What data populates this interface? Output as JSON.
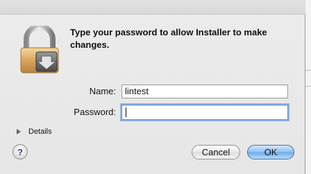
{
  "dialog": {
    "message": "Type your password to allow Installer to make changes.",
    "name_label": "Name:",
    "name_value": "lintest",
    "password_label": "Password:",
    "password_value": "",
    "details_label": "Details",
    "help_label": "?",
    "cancel_label": "Cancel",
    "ok_label": "OK",
    "lock_icon": "lock-icon",
    "accent_color": "#6fa9ea"
  }
}
